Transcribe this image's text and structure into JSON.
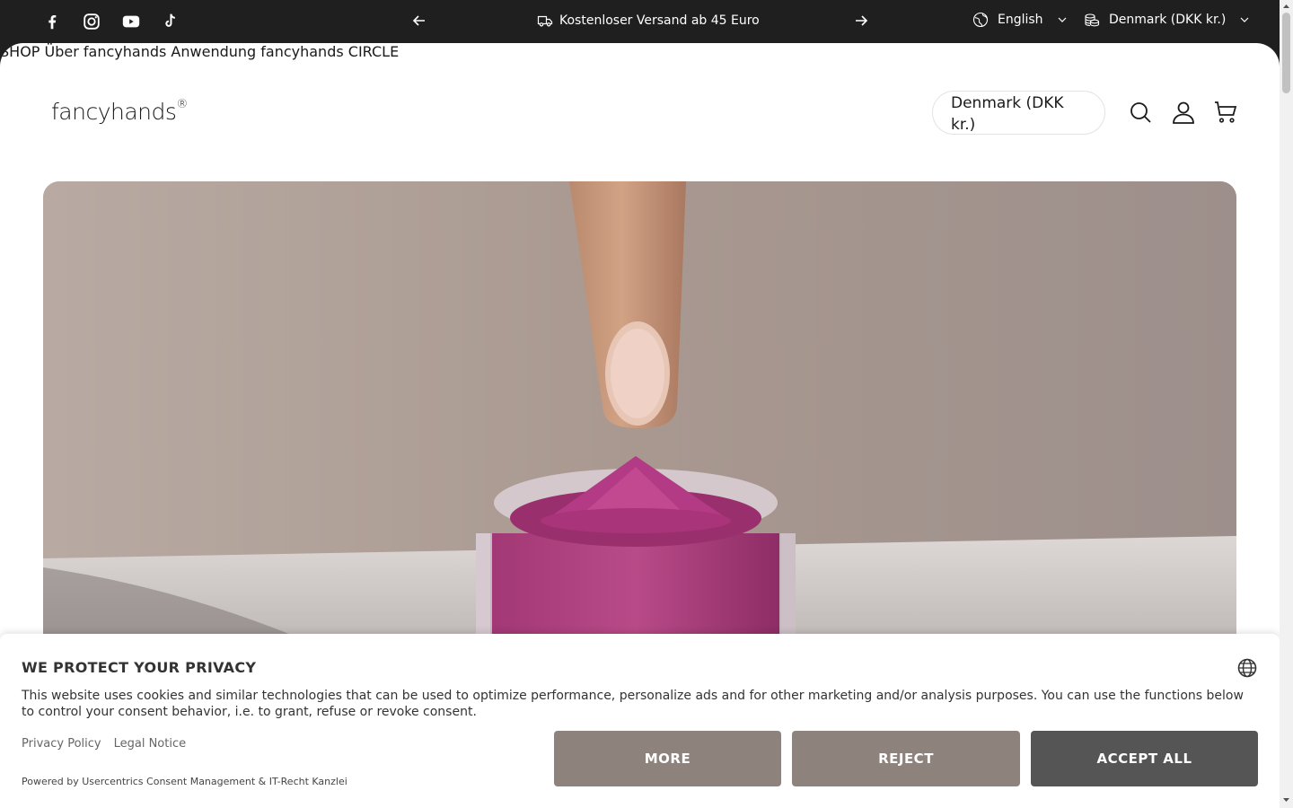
{
  "announcement": {
    "social": [
      {
        "icon": "facebook-icon"
      },
      {
        "icon": "instagram-icon"
      },
      {
        "icon": "youtube-icon"
      },
      {
        "icon": "tiktok-icon"
      }
    ],
    "message": "Kostenloser Versand ab 45 Euro",
    "message_icon": "truck-icon",
    "language": "English",
    "currency": "Denmark (DKK kr.)"
  },
  "header": {
    "logo": "fancyhands",
    "logo_mark": "®",
    "nav": [
      "SHOP",
      "Über fancyhands",
      "Anwendung",
      "fancyhands CIRCLE"
    ],
    "country_selector": "Denmark (DKK kr.)",
    "icons": [
      "search-icon",
      "account-icon",
      "cart-icon"
    ]
  },
  "hero": {
    "image": "finger-above-pink-dip-powder-jar"
  },
  "consent": {
    "title": "WE PROTECT YOUR PRIVACY",
    "body": "This website uses cookies and similar technologies that can be used to optimize performance, personalize ads and for other marketing and/or analysis purposes. You can use the functions below to control your consent behavior, i.e. to grant, refuse or revoke consent.",
    "links": [
      "Privacy Policy",
      "Legal Notice"
    ],
    "powered_by": "Powered by Usercentrics Consent Management & IT-Recht Kanzlei",
    "buttons": {
      "more": "MORE",
      "reject": "REJECT",
      "accept": "ACCEPT ALL"
    }
  },
  "colors": {
    "topbar": "#1f1f1f",
    "button_secondary": "#8e837c",
    "button_primary": "#565555",
    "powder": "#b0307a"
  }
}
